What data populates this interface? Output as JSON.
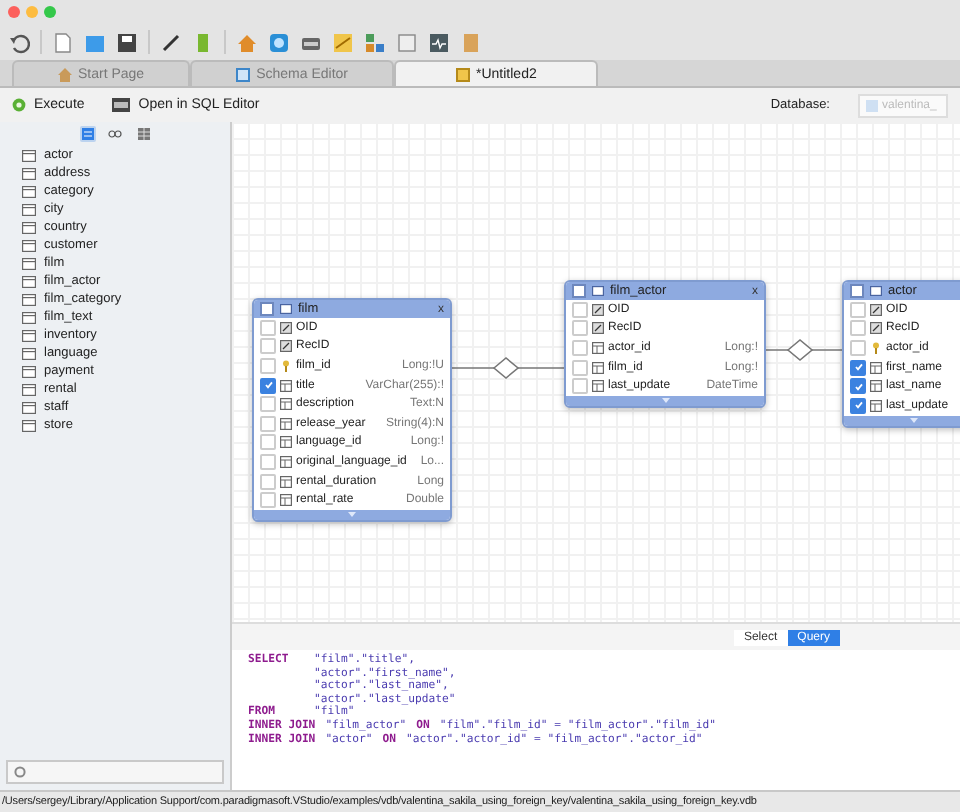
{
  "tabs": [
    {
      "label": "Start Page",
      "selected": false,
      "kind": "home"
    },
    {
      "label": "Schema Editor",
      "selected": false,
      "kind": "schema"
    },
    {
      "label": "*Untitled2",
      "selected": true,
      "kind": "query"
    }
  ],
  "actions": [
    {
      "label": "Execute",
      "kind": "execute"
    },
    {
      "label": "Open in SQL Editor",
      "kind": "sql-editor"
    }
  ],
  "database": {
    "label": "Database:",
    "value": "valentina_"
  },
  "sidebar": {
    "view_modes": [
      {
        "selected": true
      },
      {
        "selected": false
      },
      {
        "selected": false
      }
    ],
    "items": [
      "actor",
      "address",
      "category",
      "city",
      "country",
      "customer",
      "film",
      "film_actor",
      "film_category",
      "film_text",
      "inventory",
      "language",
      "payment",
      "rental",
      "staff",
      "store"
    ]
  },
  "diagram": {
    "tables": [
      {
        "name": "film",
        "close": "x",
        "all_checked": false,
        "fields": [
          {
            "name": "OID",
            "kind": "oid",
            "checked": false
          },
          {
            "name": "RecID",
            "kind": "oid",
            "checked": false
          },
          {
            "name": "film_id",
            "type": "Long:!U",
            "kind": "key",
            "checked": false
          },
          {
            "name": "title",
            "type": "VarChar(255):!",
            "kind": "field",
            "checked": true
          },
          {
            "name": "description",
            "type": "Text:N",
            "kind": "field",
            "checked": false
          },
          {
            "name": "release_year",
            "type": "String(4):N",
            "kind": "field",
            "checked": false
          },
          {
            "name": "language_id",
            "type": "Long:!",
            "kind": "field",
            "checked": false
          },
          {
            "name": "original_language_id",
            "type": "Lo...",
            "kind": "field",
            "checked": false
          },
          {
            "name": "rental_duration",
            "type": "Long",
            "kind": "field",
            "checked": false
          },
          {
            "name": "rental_rate",
            "type": "Double",
            "kind": "field",
            "checked": false
          }
        ]
      },
      {
        "name": "film_actor",
        "close": "x",
        "all_checked": false,
        "fields": [
          {
            "name": "OID",
            "kind": "oid",
            "checked": false
          },
          {
            "name": "RecID",
            "kind": "oid",
            "checked": false
          },
          {
            "name": "actor_id",
            "type": "Long:!",
            "kind": "field",
            "checked": false
          },
          {
            "name": "film_id",
            "type": "Long:!",
            "kind": "field",
            "checked": false
          },
          {
            "name": "last_update",
            "type": "DateTime",
            "kind": "field",
            "checked": false
          }
        ]
      },
      {
        "name": "actor",
        "all_checked": false,
        "fields": [
          {
            "name": "OID",
            "kind": "oid",
            "checked": false
          },
          {
            "name": "RecID",
            "kind": "oid",
            "checked": false
          },
          {
            "name": "actor_id",
            "kind": "key",
            "checked": false
          },
          {
            "name": "first_name",
            "kind": "field",
            "checked": true
          },
          {
            "name": "last_name",
            "kind": "field",
            "checked": true
          },
          {
            "name": "last_update",
            "kind": "field",
            "checked": true
          }
        ]
      }
    ]
  },
  "query_panel": {
    "modes": [
      {
        "label": "Select",
        "selected": false
      },
      {
        "label": "Query",
        "selected": true
      }
    ],
    "sql": [
      [
        {
          "kind": "keyword",
          "text": "SELECT"
        },
        {
          "kind": "string",
          "text": "\"film\".\"title\","
        }
      ],
      [
        {
          "kind": "indent"
        },
        {
          "kind": "string",
          "text": "\"actor\".\"first_name\","
        }
      ],
      [
        {
          "kind": "indent"
        },
        {
          "kind": "string",
          "text": "\"actor\".\"last_name\","
        }
      ],
      [
        {
          "kind": "indent"
        },
        {
          "kind": "string",
          "text": "\"actor\".\"last_update\""
        }
      ],
      [
        {
          "kind": "keyword",
          "text": "FROM"
        },
        {
          "kind": "string",
          "text": "\"film\""
        }
      ],
      [
        {
          "kind": "keyword",
          "text": "INNER JOIN"
        },
        {
          "kind": "string",
          "text": "\"film_actor\""
        },
        {
          "kind": "keyword",
          "text": "ON"
        },
        {
          "kind": "string",
          "text": "\"film\".\"film_id\" = \"film_actor\".\"film_id\""
        }
      ],
      [
        {
          "kind": "keyword",
          "text": "INNER JOIN"
        },
        {
          "kind": "string",
          "text": "\"actor\""
        },
        {
          "kind": "keyword",
          "text": "ON"
        },
        {
          "kind": "string",
          "text": "\"actor\".\"actor_id\" = \"film_actor\".\"actor_id\""
        }
      ]
    ]
  },
  "status_bar": {
    "path": "/Users/sergey/Library/Application Support/com.paradigmasoft.VStudio/examples/vdb/valentina_sakila_using_foreign_key/valentina_sakila_using_foreign_key.vdb"
  }
}
